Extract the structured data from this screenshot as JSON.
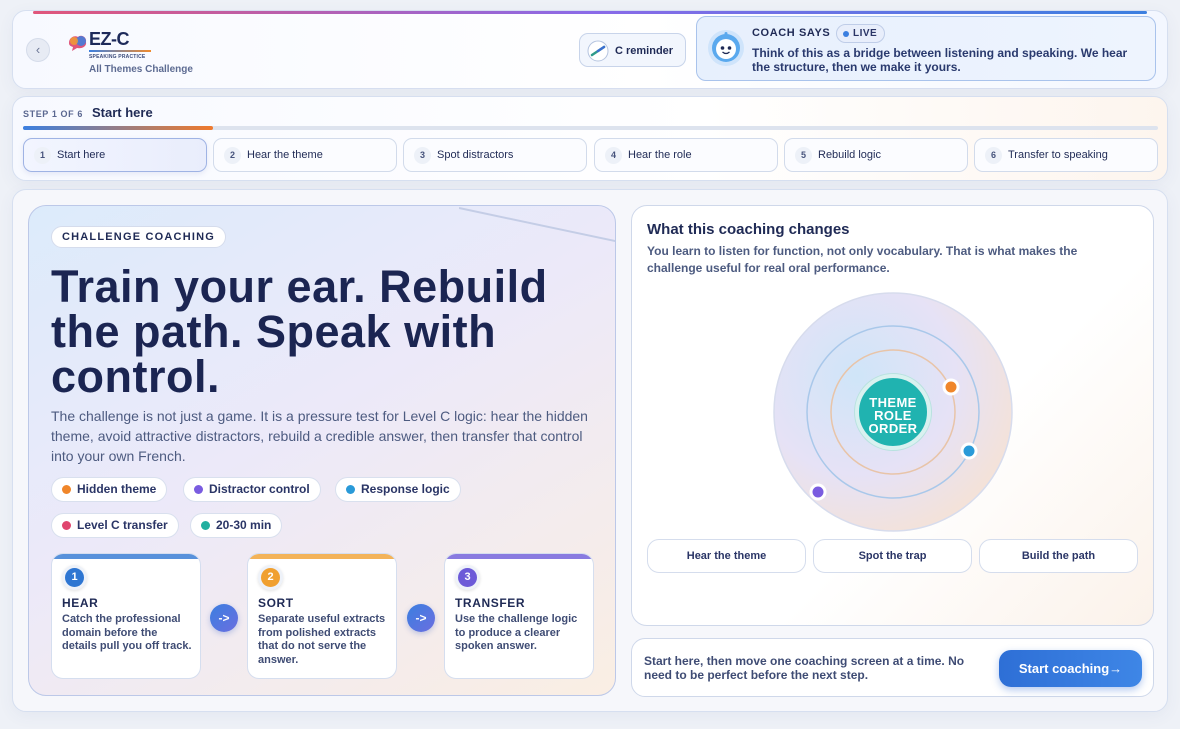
{
  "header": {
    "back_icon": "‹",
    "brand_name": "EZ-C",
    "brand_sub": "SPEAKING PRACTICE",
    "brand_tag": "All Themes Challenge",
    "reminder_label": "C reminder",
    "coach_title": "COACH SAYS",
    "live_label": "LIVE",
    "coach_text": "Think of this as a bridge between listening and speaking. We hear the structure, then we make it yours."
  },
  "steps": {
    "counter": "STEP 1 OF 6",
    "current": "Start here",
    "progress_fraction": 0.167,
    "items": [
      {
        "num": "1",
        "label": "Start here"
      },
      {
        "num": "2",
        "label": "Hear the theme"
      },
      {
        "num": "3",
        "label": "Spot distractors"
      },
      {
        "num": "4",
        "label": "Hear the role"
      },
      {
        "num": "5",
        "label": "Rebuild logic"
      },
      {
        "num": "6",
        "label": "Transfer to speaking"
      }
    ]
  },
  "hero": {
    "badge": "CHALLENGE COACHING",
    "title": "Train your ear. Rebuild the path. Speak with control.",
    "description": "The challenge is not just a game. It is a pressure test for Level C logic: hear the hidden theme, avoid attractive distractors, rebuild a credible answer, then transfer that control into your own French.",
    "chips": [
      {
        "label": "Hidden theme",
        "color": "#f0862a"
      },
      {
        "label": "Distractor control",
        "color": "#7a5ce0"
      },
      {
        "label": "Response logic",
        "color": "#2a9ad8"
      },
      {
        "label": "Level C transfer",
        "color": "#e0456e"
      },
      {
        "label": "20-30 min",
        "color": "#22b0a0"
      }
    ],
    "process": [
      {
        "num": "1",
        "title": "HEAR",
        "text": "Catch the professional domain before the details pull you off track.",
        "color": "#2e76d2"
      },
      {
        "num": "2",
        "title": "SORT",
        "text": "Separate useful extracts from polished extracts that do not serve the answer.",
        "color": "#f0a030"
      },
      {
        "num": "3",
        "title": "TRANSFER",
        "text": "Use the challenge logic to produce a clearer spoken answer.",
        "color": "#6c5ad8"
      }
    ],
    "arrow_label": "->"
  },
  "changes": {
    "title": "What this coaching changes",
    "description": "You learn to listen for function, not only vocabulary. That is what makes the challenge useful for real oral performance.",
    "center_words": [
      "THEME",
      "ROLE",
      "ORDER"
    ],
    "orbit_dot_colors": [
      "#f0862a",
      "#2a9ad8",
      "#7a5ce0"
    ],
    "pills": [
      "Hear the theme",
      "Spot the trap",
      "Build the path"
    ]
  },
  "cta": {
    "text": "Start here, then move one coaching screen at a time. No need to be perfect before the next step.",
    "button_label": "Start coaching→"
  }
}
